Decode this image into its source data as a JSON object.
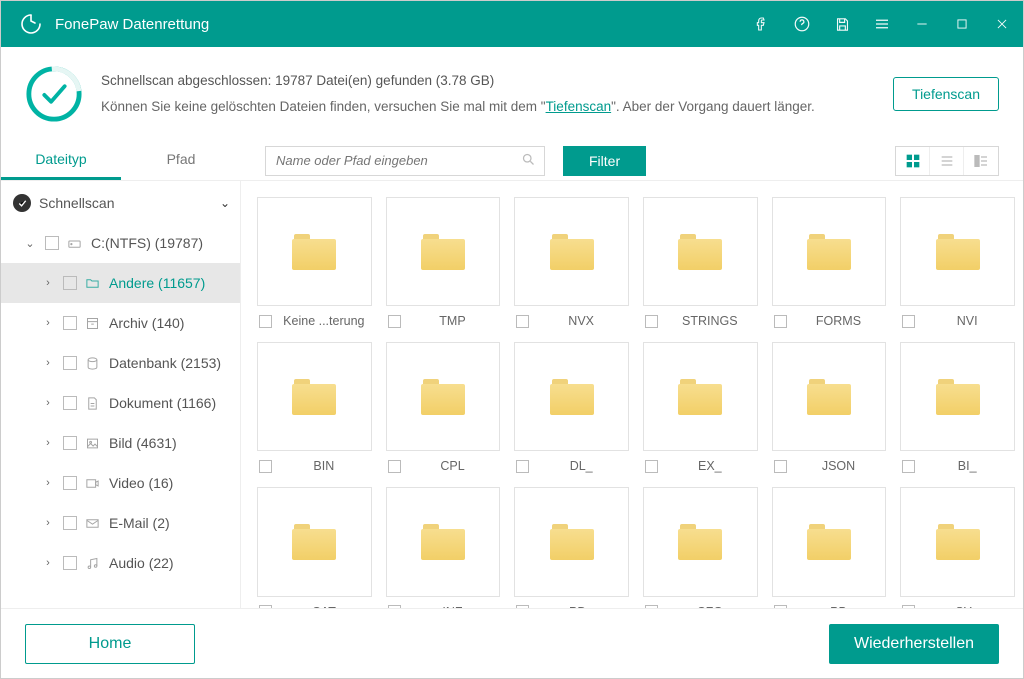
{
  "colors": {
    "accent": "#009b8e"
  },
  "titlebar": {
    "app_name": "FonePaw Datenrettung"
  },
  "status": {
    "line1": "Schnellscan abgeschlossen: 19787 Datei(en) gefunden (3.78 GB)",
    "line2_pre": "Können Sie keine gelöschten Dateien finden, versuchen Sie mal mit dem \"",
    "deep_link": "Tiefenscan",
    "line2_post": "\". Aber der Vorgang dauert länger.",
    "deepscan_button": "Tiefenscan"
  },
  "tabs": {
    "filetype": "Dateityp",
    "path": "Pfad"
  },
  "search": {
    "placeholder": "Name oder Pfad eingeben"
  },
  "filter_button": "Filter",
  "sidebar": {
    "quickscan": "Schnellscan",
    "drive": "C:(NTFS) (19787)",
    "items": [
      {
        "label": "Andere (11657)",
        "selected": true
      },
      {
        "label": "Archiv (140)"
      },
      {
        "label": "Datenbank (2153)"
      },
      {
        "label": "Dokument (1166)"
      },
      {
        "label": "Bild (4631)"
      },
      {
        "label": "Video (16)"
      },
      {
        "label": "E-Mail (2)"
      },
      {
        "label": "Audio (22)"
      }
    ]
  },
  "folders": [
    "Keine ...terung",
    "TMP",
    "NVX",
    "STRINGS",
    "FORMS",
    "NVI",
    "BIN",
    "CPL",
    "DL_",
    "EX_",
    "JSON",
    "BI_",
    "CAT",
    "INF",
    "PD_",
    "CFG",
    "PB",
    "SY_"
  ],
  "footer": {
    "home": "Home",
    "recover": "Wiederherstellen"
  }
}
